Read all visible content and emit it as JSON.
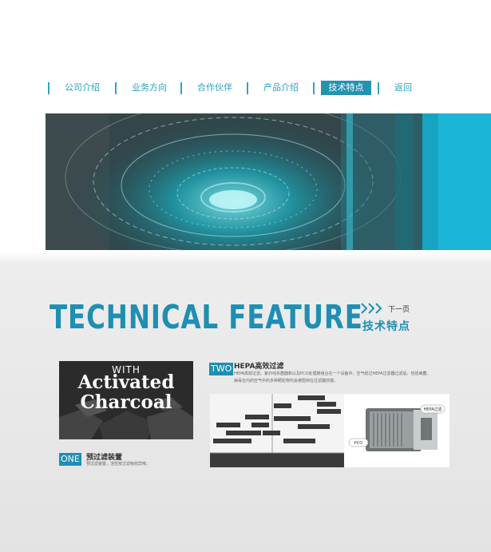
{
  "nav": {
    "items": [
      {
        "label": "公司介绍",
        "active": false
      },
      {
        "label": "业务方向",
        "active": false
      },
      {
        "label": "合作伙伴",
        "active": false
      },
      {
        "label": "产品介绍",
        "active": false
      },
      {
        "label": "技术特点",
        "active": true
      },
      {
        "label": "返回",
        "active": false
      }
    ]
  },
  "section": {
    "title": "TECHNICAL FEATURE",
    "subtitle": "技术特点",
    "next_label": "下一页"
  },
  "item_one": {
    "badge": "ONE",
    "title": "预过滤装置",
    "desc": "预过滤装置，活性炭过滤吸收异味。",
    "image": {
      "small": "WITH",
      "line1": "Activated",
      "line2": "Charcoal"
    }
  },
  "item_two": {
    "badge": "TWO",
    "title": "HEPA高效过滤",
    "desc_line1": "HEPA高效过滤，紫外线杀菌器和以及PCO处理被组合在一个设备中。空气经过HEPA过滤器过滤后，包括病菌、",
    "desc_line2": "病毒在内的空气中的多种颗粒物均会被阻挡在过滤器前端。",
    "diagram_labels": {
      "hepa": "HEPA过滤",
      "pco": "PCO"
    }
  },
  "colors": {
    "accent": "#1e8fb2",
    "nav": "#2aa0c0",
    "banner_strip": "#1bb6d6"
  }
}
